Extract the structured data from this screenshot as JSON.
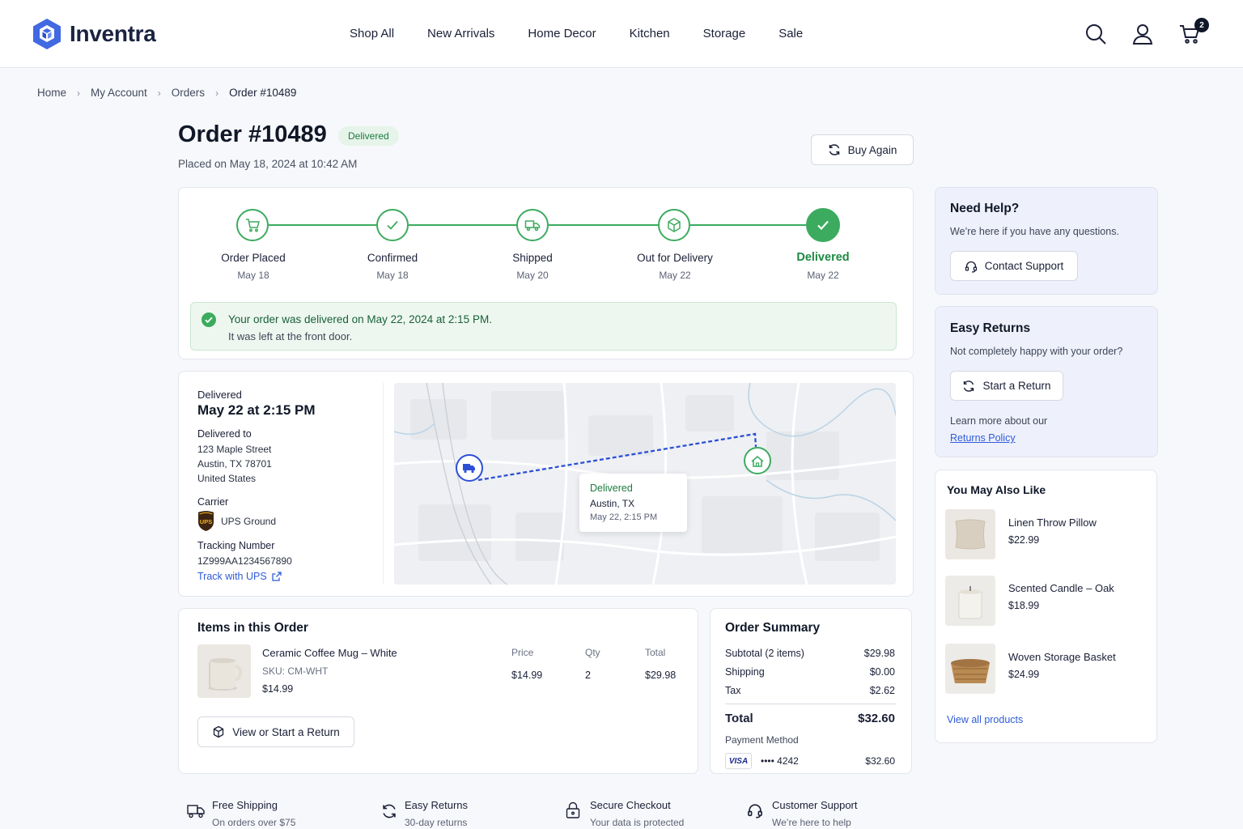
{
  "brand": {
    "name": "Inventra",
    "accent": "#4169e1",
    "success": "#3cab5f"
  },
  "nav": [
    "Shop All",
    "New Arrivals",
    "Home Decor",
    "Kitchen",
    "Storage",
    "Sale"
  ],
  "header_icons": {
    "search": "search-icon",
    "account": "user-icon",
    "cart": "cart-icon",
    "cart_count": "2"
  },
  "breadcrumb": [
    "Home",
    "My Account",
    "Orders",
    "Order #10489"
  ],
  "order": {
    "title": "Order #10489",
    "status": "Delivered",
    "placed": "Placed on May 18, 2024 at 10:42 AM",
    "buy_again": "Buy Again"
  },
  "timeline": [
    {
      "label": "Order Placed",
      "date": "May 18",
      "icon": "cart-icon"
    },
    {
      "label": "Confirmed",
      "date": "May 18",
      "icon": "check-icon"
    },
    {
      "label": "Shipped",
      "date": "May 20",
      "icon": "truck-icon"
    },
    {
      "label": "Out for Delivery",
      "date": "May 22",
      "icon": "box-icon"
    },
    {
      "label": "Delivered",
      "date": "May 22",
      "icon": "check-icon"
    }
  ],
  "notice": {
    "line1": "Your order was delivered on May 22, 2024 at 2:15 PM.",
    "line2": "It was left at the front door."
  },
  "delivery": {
    "status": "Delivered",
    "time": "May 22 at 2:15 PM",
    "to_label": "Delivered to",
    "address": [
      "123 Maple Street",
      "Austin, TX 78701",
      "United States"
    ],
    "carrier_label": "Carrier",
    "carrier_logo": "UPS",
    "carrier": "UPS Ground",
    "tracking_label": "Tracking Number",
    "tracking": "1Z999AA1234567890",
    "track_link": "Track with UPS",
    "popup": {
      "status": "Delivered",
      "city": "Austin, TX",
      "time": "May 22, 2:15 PM"
    }
  },
  "items": {
    "title": "Items in this Order",
    "headers": {
      "price": "Price",
      "qty": "Qty",
      "total": "Total"
    },
    "list": [
      {
        "name": "Ceramic Coffee Mug – White",
        "sku": "SKU: CM-WHT",
        "unit": "$14.99",
        "price": "$14.99",
        "qty": "2",
        "total": "$29.98"
      }
    ],
    "return_btn": "View or Start a Return"
  },
  "summary": {
    "title": "Order Summary",
    "rows": [
      {
        "label": "Subtotal (2 items)",
        "value": "$29.98"
      },
      {
        "label": "Shipping",
        "value": "$0.00"
      },
      {
        "label": "Tax",
        "value": "$2.62"
      }
    ],
    "total_label": "Total",
    "total": "$32.60",
    "payment_label": "Payment Method",
    "card_brand": "VISA",
    "card": "•••• 4242",
    "paid": "$32.60"
  },
  "help": {
    "title": "Need Help?",
    "text": "We’re here if you have any questions.",
    "btn": "Contact Support"
  },
  "returns": {
    "title": "Easy Returns",
    "text": "Not completely happy with your order?",
    "btn": "Start a Return",
    "learn": "Learn more about our",
    "policy": "Returns Policy"
  },
  "recs": {
    "title": "You May Also Like",
    "list": [
      {
        "name": "Linen Throw Pillow",
        "price": "$22.99"
      },
      {
        "name": "Scented Candle – Oak",
        "price": "$18.99"
      },
      {
        "name": "Woven Storage Basket",
        "price": "$24.99"
      }
    ],
    "view_all": "View all products"
  },
  "features": [
    {
      "title": "Free Shipping",
      "sub": "On orders over $75",
      "icon": "truck-icon"
    },
    {
      "title": "Easy Returns",
      "sub": "30-day returns",
      "icon": "refresh-icon"
    },
    {
      "title": "Secure Checkout",
      "sub": "Your data is protected",
      "icon": "lock-icon"
    },
    {
      "title": "Customer Support",
      "sub": "We’re here to help",
      "icon": "headset-icon"
    }
  ]
}
